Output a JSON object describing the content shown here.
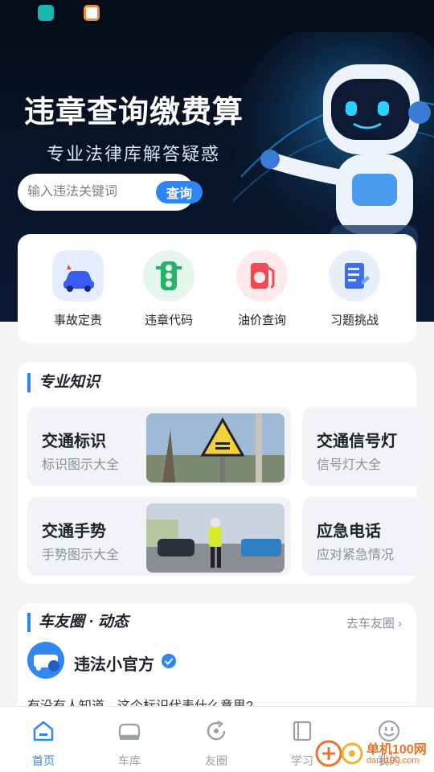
{
  "hero": {
    "title": "违章查询缴费算",
    "subtitle": "专业法律库解答疑惑"
  },
  "search": {
    "placeholder": "输入违法关键词",
    "button_label": "查询"
  },
  "quick_actions": [
    {
      "label": "事故定责",
      "icon": "car-accident-icon"
    },
    {
      "label": "违章代码",
      "icon": "traffic-light-icon"
    },
    {
      "label": "油价查询",
      "icon": "fuel-pump-icon"
    },
    {
      "label": "习题挑战",
      "icon": "quiz-book-icon"
    }
  ],
  "knowledge": {
    "title": "专业知识",
    "cards": [
      {
        "title": "交通标识",
        "subtitle": "标识图示大全",
        "image": "pedestrian-crossing-sign-photo"
      },
      {
        "title": "交通信号灯",
        "subtitle": "信号灯大全"
      },
      {
        "title": "交通手势",
        "subtitle": "手势图示大全",
        "image": "traffic-police-photo"
      },
      {
        "title": "应急电话",
        "subtitle": "应对紧急情况"
      }
    ]
  },
  "community": {
    "title": "车友圈 · 动态",
    "link": "去车友圈",
    "post": {
      "author": "违法小官方",
      "text": "有没有人知道，这个标识代表什么意思?"
    }
  },
  "bottom_nav": [
    {
      "label": "首页",
      "icon": "home-icon",
      "active": true
    },
    {
      "label": "车库",
      "icon": "car-icon",
      "active": false
    },
    {
      "label": "友圈",
      "icon": "refresh-circle-icon",
      "active": false
    },
    {
      "label": "学习",
      "icon": "book-icon",
      "active": false
    },
    {
      "label": "我的",
      "icon": "smiley-icon",
      "active": false
    }
  ],
  "watermark": {
    "name": "单机100网",
    "url": "danji100.com"
  },
  "colors": {
    "accent": "#2e86f5",
    "hero_bg": "#071427"
  }
}
